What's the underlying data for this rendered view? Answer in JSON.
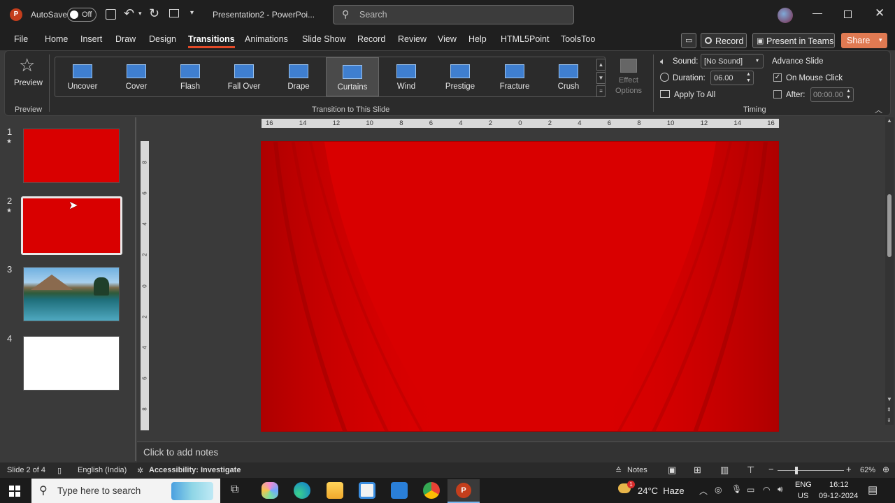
{
  "titlebar": {
    "autosave_label": "AutoSave",
    "autosave_state": "Off",
    "doc_title": "Presentation2 - PowerPoi...",
    "search_placeholder": "Search"
  },
  "menu": {
    "items": [
      "File",
      "Home",
      "Insert",
      "Draw",
      "Design",
      "Transitions",
      "Animations",
      "Slide Show",
      "Record",
      "Review",
      "View",
      "Help",
      "HTML5Point",
      "ToolsToo"
    ],
    "active": "Transitions",
    "record_btn": "Record",
    "teams_btn": "Present in Teams",
    "share_btn": "Share"
  },
  "ribbon": {
    "preview_label": "Preview",
    "preview_group": "Preview",
    "transitions": [
      "Uncover",
      "Cover",
      "Flash",
      "Fall Over",
      "Drape",
      "Curtains",
      "Wind",
      "Prestige",
      "Fracture",
      "Crush"
    ],
    "selected_transition": "Curtains",
    "effect_options": "Effect Options",
    "group_label": "Transition to This Slide",
    "sound_label": "Sound:",
    "sound_value": "[No Sound]",
    "duration_label": "Duration:",
    "duration_value": "06.00",
    "apply_all": "Apply To All",
    "advance_label": "Advance Slide",
    "on_mouse_click": "On Mouse Click",
    "after_label": "After:",
    "after_value": "00:00.00",
    "timing_group": "Timing"
  },
  "slides": [
    {
      "num": "1",
      "star": "★",
      "kind": "red"
    },
    {
      "num": "2",
      "star": "★",
      "kind": "red"
    },
    {
      "num": "3",
      "star": "",
      "kind": "landscape"
    },
    {
      "num": "4",
      "star": "",
      "kind": "white"
    }
  ],
  "ruler_h": [
    "16",
    "14",
    "12",
    "10",
    "8",
    "6",
    "4",
    "2",
    "0",
    "2",
    "4",
    "6",
    "8",
    "10",
    "12",
    "14",
    "16"
  ],
  "ruler_v": [
    "8",
    "6",
    "4",
    "2",
    "0",
    "2",
    "4",
    "6",
    "8"
  ],
  "notes_placeholder": "Click to add notes",
  "status": {
    "slide_info": "Slide 2 of 4",
    "language": "English (India)",
    "accessibility": "Accessibility: Investigate",
    "notes_btn": "Notes",
    "zoom": "62%"
  },
  "taskbar": {
    "search_placeholder": "Type here to search",
    "weather": "24°C  Haze",
    "weather_badge": "1",
    "lang": "ENG",
    "region": "US",
    "time": "16:12",
    "date": "09-12-2024"
  },
  "colors": {
    "accent": "#e24a28",
    "slide_red": "#d90000",
    "ribbon_bg": "#2b2b2b"
  }
}
